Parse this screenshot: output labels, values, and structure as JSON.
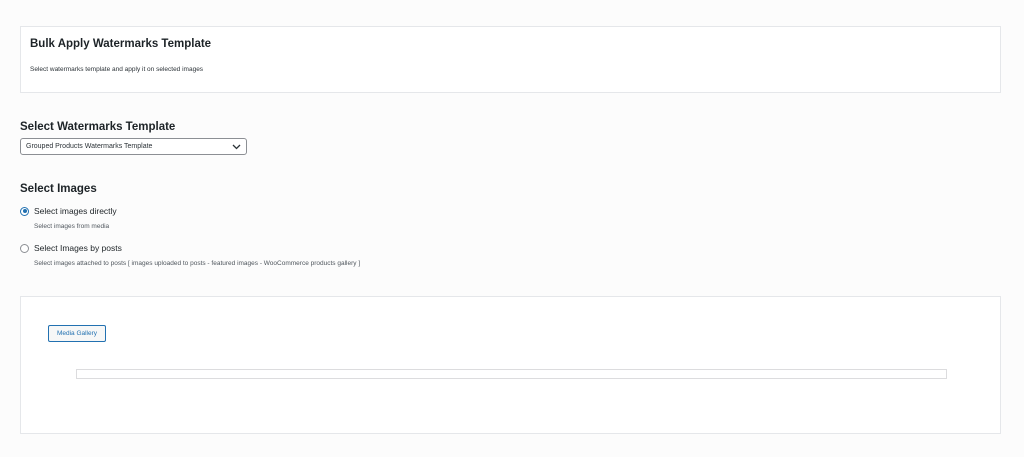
{
  "header": {
    "title": "Bulk Apply Watermarks Template",
    "description": "Select watermarks template and apply it on selected images"
  },
  "template_section": {
    "title": "Select Watermarks Template",
    "selected_value": "Grouped Products Watermarks Template"
  },
  "images_section": {
    "title": "Select Images",
    "options": [
      {
        "label": "Select images directly",
        "description": "Select images from media",
        "checked": true
      },
      {
        "label": "Select Images by posts",
        "description": "Select images attached to posts [ images uploaded to posts - featured images - WooCommerce products gallery ]",
        "checked": false
      }
    ]
  },
  "media": {
    "button_label": "Media Gallery"
  },
  "colors": {
    "accent": "#2271b1",
    "border": "#8c8f94"
  }
}
